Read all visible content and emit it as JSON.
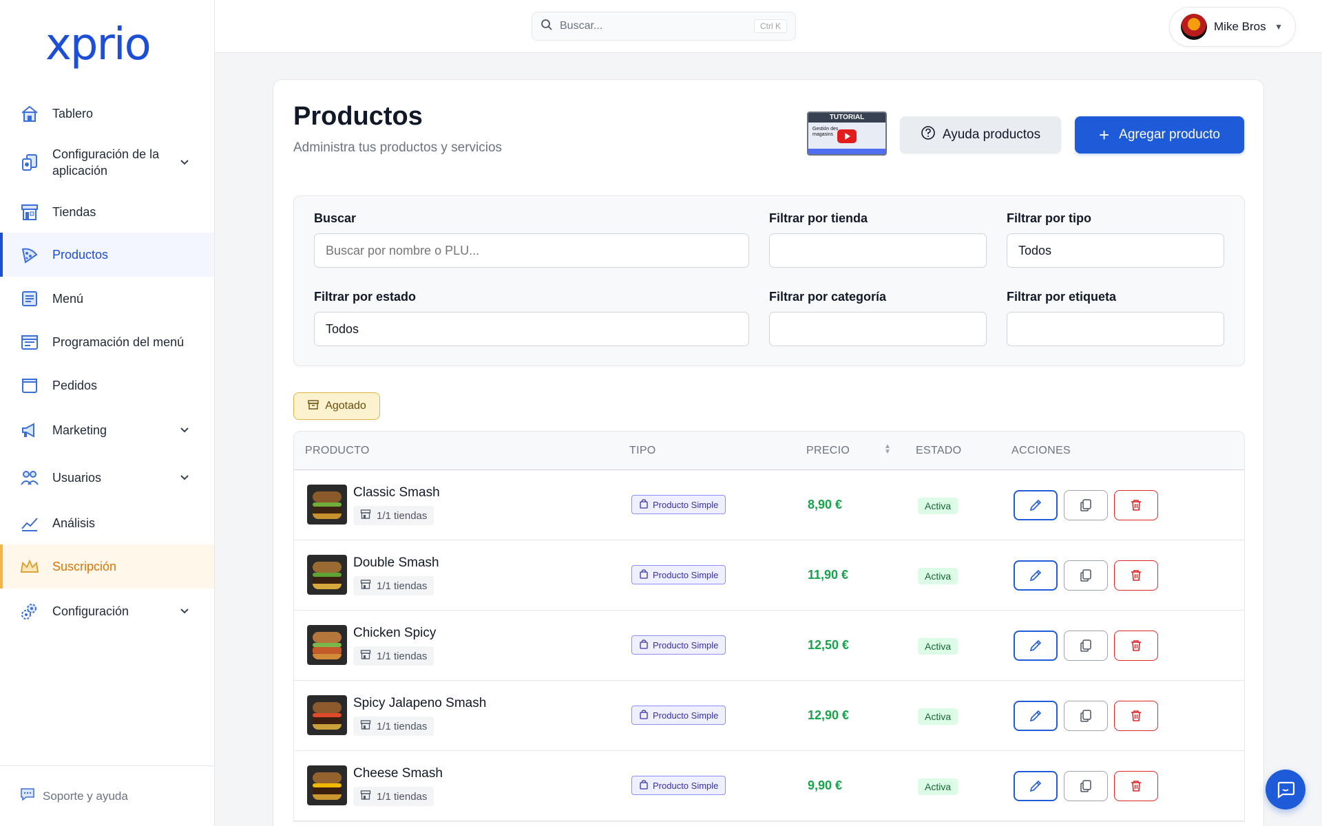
{
  "app": {
    "logo_text": "xprio",
    "brand_color": "#1d4ed8"
  },
  "sidebar": {
    "items": [
      {
        "label": "Tablero",
        "icon": "home-icon",
        "expandable": false
      },
      {
        "label": "Configuración de la aplicación",
        "icon": "app-config-icon",
        "expandable": true
      },
      {
        "label": "Tiendas",
        "icon": "store-icon",
        "expandable": false
      },
      {
        "label": "Productos",
        "icon": "pizza-icon",
        "expandable": false,
        "active": true
      },
      {
        "label": "Menú",
        "icon": "menu-list-icon",
        "expandable": false
      },
      {
        "label": "Programación del menú",
        "icon": "schedule-icon",
        "expandable": false
      },
      {
        "label": "Pedidos",
        "icon": "orders-icon",
        "expandable": false
      },
      {
        "label": "Marketing",
        "icon": "megaphone-icon",
        "expandable": true
      },
      {
        "label": "Usuarios",
        "icon": "users-icon",
        "expandable": true
      },
      {
        "label": "Análisis",
        "icon": "analytics-icon",
        "expandable": false
      },
      {
        "label": "Suscripción",
        "icon": "crown-icon",
        "expandable": false,
        "highlight": true
      },
      {
        "label": "Configuración",
        "icon": "gears-icon",
        "expandable": true
      }
    ],
    "footer": {
      "label": "Soporte y ayuda",
      "icon": "chat-bubble-icon"
    }
  },
  "header": {
    "search": {
      "placeholder": "Buscar...",
      "shortcut": "Ctrl K"
    },
    "user": {
      "name": "Mike Bros"
    }
  },
  "page": {
    "title": "Productos",
    "subtitle": "Administra tus productos y servicios",
    "tutorial": {
      "label": "TUTORIAL",
      "caption": "Gestión des magasins"
    },
    "help_button": "Ayuda productos",
    "add_button": "Agregar producto"
  },
  "filters": {
    "search": {
      "label": "Buscar",
      "placeholder": "Buscar por nombre o PLU..."
    },
    "store": {
      "label": "Filtrar por tienda",
      "value": ""
    },
    "type": {
      "label": "Filtrar por tipo",
      "value": "Todos"
    },
    "status": {
      "label": "Filtrar por estado",
      "value": "Todos"
    },
    "category": {
      "label": "Filtrar por categoría",
      "value": ""
    },
    "tag": {
      "label": "Filtrar por etiqueta",
      "value": ""
    }
  },
  "out_of_stock_badge": "Agotado",
  "table": {
    "columns": {
      "product": "PRODUCTO",
      "type": "TIPO",
      "price": "PRECIO",
      "status": "ESTADO",
      "actions": "ACCIONES"
    },
    "rows": [
      {
        "name": "Classic Smash",
        "stores": "1/1 tiendas",
        "type": "Producto Simple",
        "price": "8,90 €",
        "status": "Activa"
      },
      {
        "name": "Double Smash",
        "stores": "1/1 tiendas",
        "type": "Producto Simple",
        "price": "11,90 €",
        "status": "Activa"
      },
      {
        "name": "Chicken Spicy",
        "stores": "1/1 tiendas",
        "type": "Producto Simple",
        "price": "12,50 €",
        "status": "Activa"
      },
      {
        "name": "Spicy Jalapeno Smash",
        "stores": "1/1 tiendas",
        "type": "Producto Simple",
        "price": "12,90 €",
        "status": "Activa"
      },
      {
        "name": "Cheese Smash",
        "stores": "1/1 tiendas",
        "type": "Producto Simple",
        "price": "9,90 €",
        "status": "Activa"
      }
    ]
  },
  "colors": {
    "primary": "#1d5bd8",
    "price_green": "#16a34a",
    "status_bg": "#dcfce7",
    "danger": "#dc2626",
    "subscription": "#d97706"
  }
}
